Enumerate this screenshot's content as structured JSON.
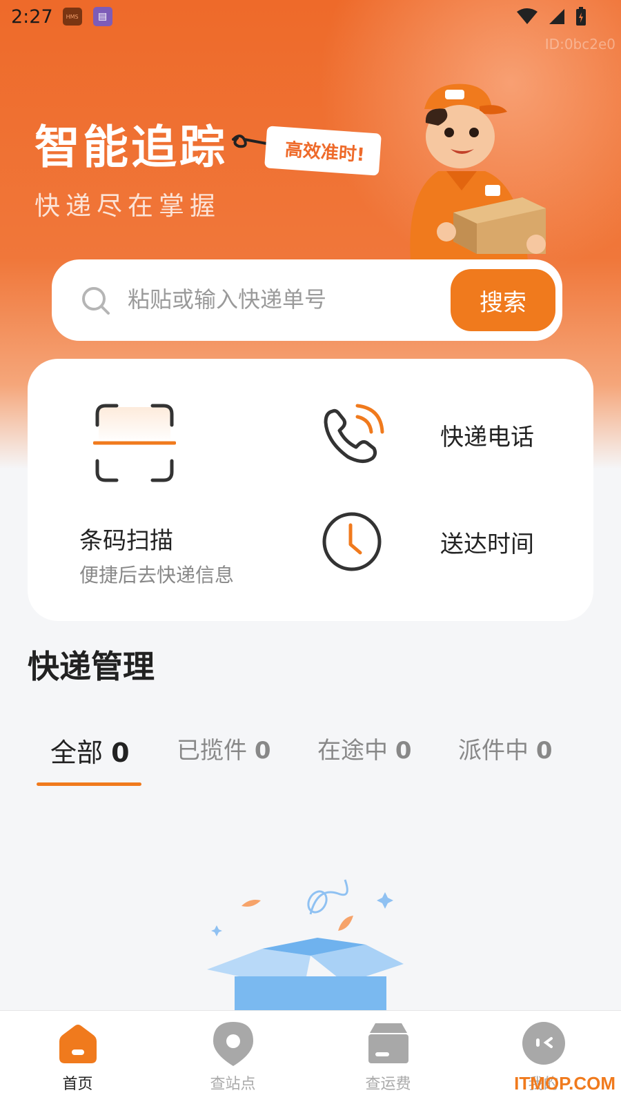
{
  "status_bar": {
    "time": "2:27",
    "hms_badge": "HMS",
    "device_id": "ID:0bc2e0"
  },
  "hero": {
    "title": "智能追踪",
    "tag": "高效准时!",
    "subtitle": "快递尽在掌握",
    "accent_color": "#ee6a2a"
  },
  "search": {
    "placeholder": "粘贴或输入快递单号",
    "button_label": "搜索"
  },
  "tools": {
    "scan_title": "条码扫描",
    "scan_desc": "便捷后去快递信息",
    "phone_label": "快递电话",
    "time_label": "送达时间"
  },
  "management": {
    "title": "快递管理",
    "tabs": [
      {
        "label": "全部",
        "count": "0"
      },
      {
        "label": "已揽件",
        "count": "0"
      },
      {
        "label": "在途中",
        "count": "0"
      },
      {
        "label": "派件中",
        "count": "0"
      }
    ]
  },
  "bottom_nav": {
    "items": [
      {
        "label": "首页",
        "icon": "home-icon"
      },
      {
        "label": "查站点",
        "icon": "location-icon"
      },
      {
        "label": "查运费",
        "icon": "box-icon"
      },
      {
        "label": "我的",
        "icon": "profile-icon"
      }
    ]
  },
  "watermark": "ITMOP.COM"
}
